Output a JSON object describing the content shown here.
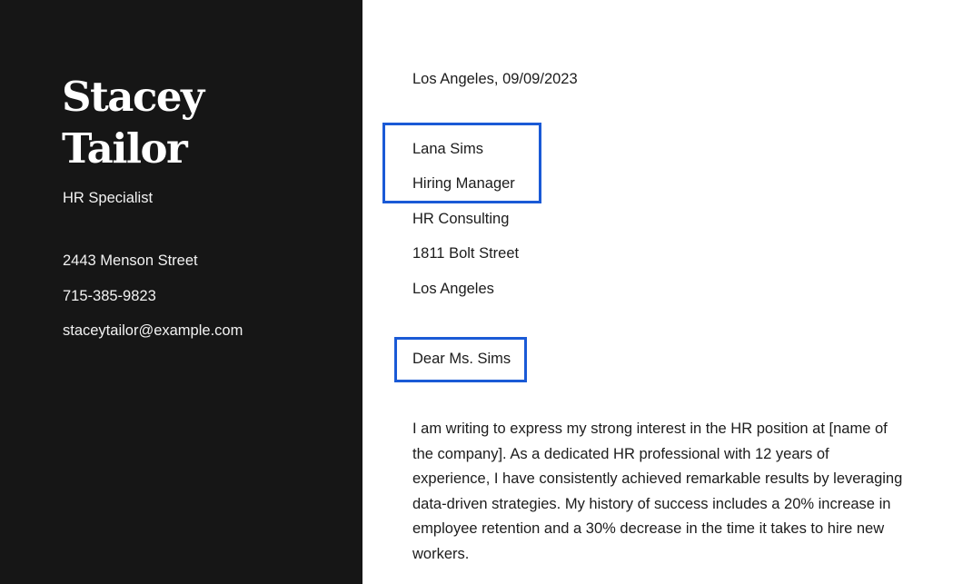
{
  "sidebar": {
    "name_first": "Stacey",
    "name_last": "Tailor",
    "job_title": "HR Specialist",
    "address": "2443 Menson Street",
    "phone": "715-385-9823",
    "email": "staceytailor@example.com",
    "background_color": "#161616"
  },
  "letter": {
    "place_date": "Los Angeles, 09/09/2023",
    "recipient": {
      "name": "Lana Sims",
      "title": "Hiring Manager",
      "company": "HR Consulting",
      "street": "1811 Bolt Street",
      "city": "Los Angeles"
    },
    "salutation": "Dear Ms. Sims",
    "body": "I am writing to express my strong interest in the HR position at [name of the company]. As a dedicated HR professional with 12 years of experience, I have consistently achieved remarkable results by leveraging data-driven strategies. My history of success includes a 20% increase in employee retention and a 30% decrease in the time it takes to hire new workers."
  },
  "highlight_color": "#1a5ad6"
}
